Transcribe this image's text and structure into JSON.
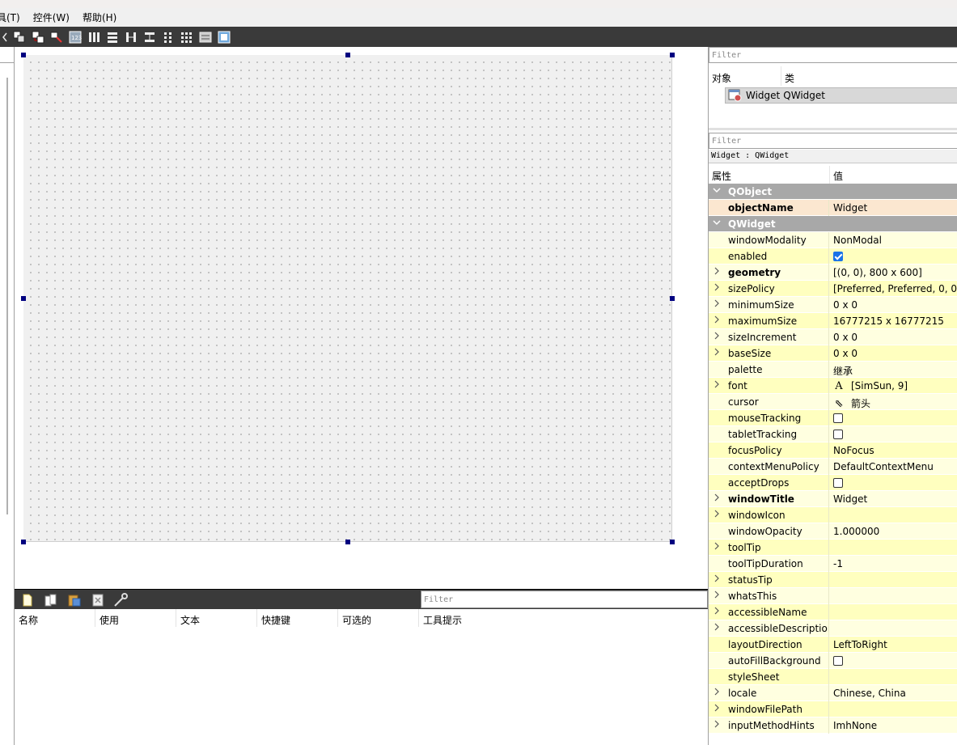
{
  "menubar": {
    "items": [
      "具(T)",
      "控件(W)",
      "帮助(H)"
    ]
  },
  "toolbar": {
    "icons": [
      "chevron-left-icon",
      "edit-widgets-icon",
      "edit-signals-slots-icon",
      "edit-buddies-icon",
      "edit-tab-order-icon",
      "layout-horizontal-icon",
      "layout-vertical-icon",
      "layout-horizontal-splitter-icon",
      "layout-vertical-splitter-icon",
      "layout-form-icon",
      "layout-grid-icon",
      "break-layout-icon",
      "adjust-size-icon"
    ]
  },
  "action_editor": {
    "filter_placeholder": "Filter",
    "columns": [
      "名称",
      "使用",
      "文本",
      "快捷键",
      "可选的",
      "工具提示"
    ]
  },
  "object_inspector": {
    "filter_placeholder": "Filter",
    "col_object": "对象",
    "col_class": "类",
    "row": {
      "name": "Widget",
      "class": "QWidget"
    }
  },
  "property_editor": {
    "filter_placeholder": "Filter",
    "title": "Widget : QWidget",
    "col_property": "属性",
    "col_value": "值",
    "rows": [
      {
        "type": "group",
        "name": "QObject",
        "expand": "v"
      },
      {
        "type": "hl",
        "name": "objectName",
        "value": "Widget",
        "bold": true
      },
      {
        "type": "group",
        "name": "QWidget",
        "expand": "v"
      },
      {
        "type": "y1",
        "name": "windowModality",
        "value": "NonModal"
      },
      {
        "type": "y2",
        "name": "enabled",
        "check": true
      },
      {
        "type": "y1",
        "name": "geometry",
        "value": "[(0, 0), 800 x 600]",
        "bold": true,
        "expand": ">"
      },
      {
        "type": "y2",
        "name": "sizePolicy",
        "value": "[Preferred, Preferred, 0, 0]",
        "expand": ">"
      },
      {
        "type": "y1",
        "name": "minimumSize",
        "value": "0 x 0",
        "expand": ">"
      },
      {
        "type": "y2",
        "name": "maximumSize",
        "value": "16777215 x 16777215",
        "expand": ">"
      },
      {
        "type": "y1",
        "name": "sizeIncrement",
        "value": "0 x 0",
        "expand": ">"
      },
      {
        "type": "y2",
        "name": "baseSize",
        "value": "0 x 0",
        "expand": ">"
      },
      {
        "type": "y1",
        "name": "palette",
        "value": "继承"
      },
      {
        "type": "y2",
        "name": "font",
        "value": "[SimSun, 9]",
        "icon": "A",
        "expand": ">"
      },
      {
        "type": "y1",
        "name": "cursor",
        "value": "箭头",
        "icon": "⇖"
      },
      {
        "type": "y2",
        "name": "mouseTracking",
        "check": false
      },
      {
        "type": "y1",
        "name": "tabletTracking",
        "check": false
      },
      {
        "type": "y2",
        "name": "focusPolicy",
        "value": "NoFocus"
      },
      {
        "type": "y1",
        "name": "contextMenuPolicy",
        "value": "DefaultContextMenu"
      },
      {
        "type": "y2",
        "name": "acceptDrops",
        "check": false
      },
      {
        "type": "y1",
        "name": "windowTitle",
        "value": "Widget",
        "bold": true,
        "expand": ">"
      },
      {
        "type": "y2",
        "name": "windowIcon",
        "value": "",
        "expand": ">"
      },
      {
        "type": "y1",
        "name": "windowOpacity",
        "value": "1.000000"
      },
      {
        "type": "y2",
        "name": "toolTip",
        "value": "",
        "expand": ">"
      },
      {
        "type": "y1",
        "name": "toolTipDuration",
        "value": "-1"
      },
      {
        "type": "y2",
        "name": "statusTip",
        "value": "",
        "expand": ">"
      },
      {
        "type": "y1",
        "name": "whatsThis",
        "value": "",
        "expand": ">"
      },
      {
        "type": "y2",
        "name": "accessibleName",
        "value": "",
        "expand": ">"
      },
      {
        "type": "y1",
        "name": "accessibleDescription",
        "value": "",
        "expand": ">"
      },
      {
        "type": "y2",
        "name": "layoutDirection",
        "value": "LeftToRight"
      },
      {
        "type": "y1",
        "name": "autoFillBackground",
        "check": false
      },
      {
        "type": "y2",
        "name": "styleSheet",
        "value": ""
      },
      {
        "type": "y1",
        "name": "locale",
        "value": "Chinese, China",
        "expand": ">"
      },
      {
        "type": "y2",
        "name": "windowFilePath",
        "value": "",
        "expand": ">"
      },
      {
        "type": "y1",
        "name": "inputMethodHints",
        "value": "ImhNone",
        "expand": ">"
      }
    ]
  }
}
